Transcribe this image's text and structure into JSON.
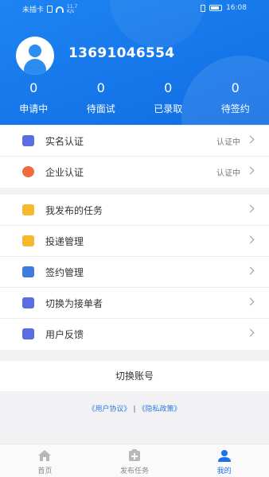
{
  "status_bar": {
    "carrier": "未插卡",
    "speed_top": "11.7",
    "speed_bottom": "K/s",
    "time": "16:08"
  },
  "profile": {
    "phone": "13691046554"
  },
  "stats": [
    {
      "value": "0",
      "label": "申请中"
    },
    {
      "value": "0",
      "label": "待面试"
    },
    {
      "value": "0",
      "label": "已录取"
    },
    {
      "value": "0",
      "label": "待签约"
    }
  ],
  "cert_group": [
    {
      "title": "实名认证",
      "status": "认证中",
      "icon": "id-card-icon",
      "color": "#5b6ee1"
    },
    {
      "title": "企业认证",
      "status": "认证中",
      "icon": "company-icon",
      "color": "#f06a3c"
    }
  ],
  "menu_group": [
    {
      "title": "我发布的任务",
      "icon": "folder-icon",
      "color": "#f5b82e"
    },
    {
      "title": "投递管理",
      "icon": "delivery-icon",
      "color": "#f5b82e"
    },
    {
      "title": "签约管理",
      "icon": "contract-icon",
      "color": "#3d7be0"
    },
    {
      "title": "切换为接单者",
      "icon": "switch-role-icon",
      "color": "#5b6ee1"
    },
    {
      "title": "用户反馈",
      "icon": "feedback-icon",
      "color": "#5b6ee1"
    }
  ],
  "switch_account": "切换账号",
  "links": {
    "user_agreement": "《用户协议》",
    "separator": "|",
    "privacy_policy": "《隐私政策》"
  },
  "tabs": [
    {
      "label": "首页",
      "icon": "home-icon",
      "active": false
    },
    {
      "label": "发布任务",
      "icon": "publish-icon",
      "active": false
    },
    {
      "label": "我的",
      "icon": "profile-icon",
      "active": true
    }
  ],
  "colors": {
    "header_blue": "#1e84f2",
    "active_tab": "#1a73e8"
  }
}
